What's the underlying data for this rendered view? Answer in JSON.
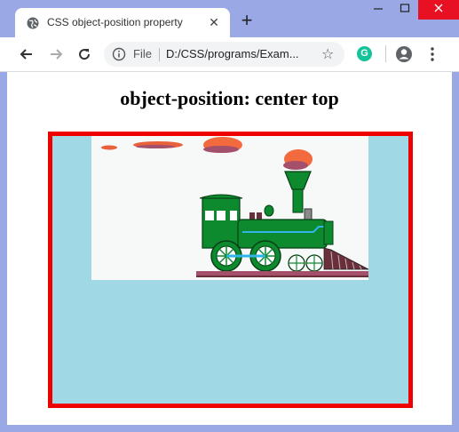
{
  "browser": {
    "tab_title": "CSS object-position property",
    "tab_close": "✕",
    "new_tab": "+",
    "omnibox_file": "File",
    "url": "D:/CSS/programs/Exam...",
    "grammarly_letter": "G"
  },
  "page": {
    "heading": "object-position: center top"
  },
  "colors": {
    "frame": "#9ba8e6",
    "box_border": "#ee0000",
    "box_background": "#a0d8e6",
    "train_body": "#0e8a2e",
    "close_button": "#e81123"
  },
  "image": {
    "icon": "steam-locomotive-with-smoke"
  }
}
